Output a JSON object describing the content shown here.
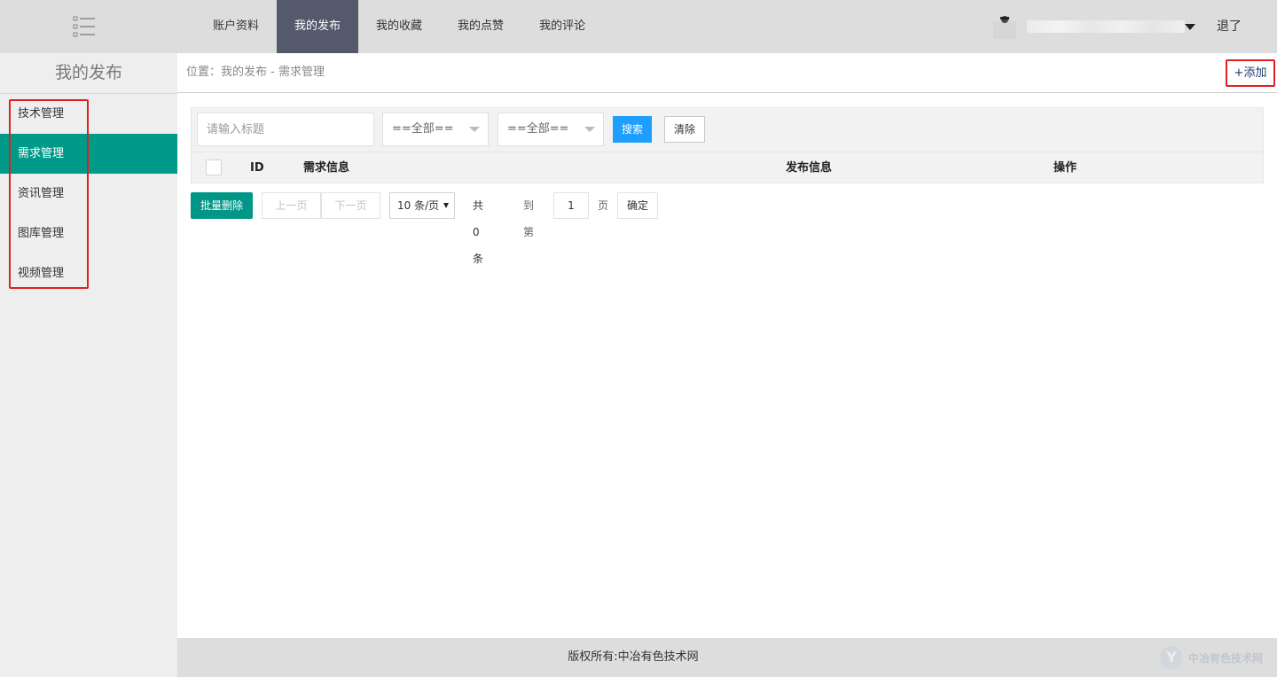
{
  "header": {
    "nav": [
      {
        "label": "账户资料",
        "active": false
      },
      {
        "label": "我的发布",
        "active": true
      },
      {
        "label": "我的收藏",
        "active": false
      },
      {
        "label": "我的点赞",
        "active": false
      },
      {
        "label": "我的评论",
        "active": false
      }
    ],
    "logout_label": "退了",
    "icons": {
      "menu": "list-menu-icon",
      "avatar": "user-avatar-icon",
      "dropdown": "caret-down-icon"
    }
  },
  "sidebar": {
    "title": "我的发布",
    "items": [
      {
        "label": "技术管理",
        "active": false
      },
      {
        "label": "需求管理",
        "active": true
      },
      {
        "label": "资讯管理",
        "active": false
      },
      {
        "label": "图库管理",
        "active": false
      },
      {
        "label": "视频管理",
        "active": false
      }
    ]
  },
  "breadcrumb": {
    "text": "位置：我的发布 - 需求管理"
  },
  "add_label": "+添加",
  "filters": {
    "search_placeholder": "请输入标题",
    "select1": "==全部==",
    "select2": "==全部==",
    "search_label": "搜索",
    "clear_label": "清除"
  },
  "table": {
    "columns": [
      "ID",
      "需求信息",
      "发布信息",
      "操作"
    ],
    "rows": []
  },
  "pagination": {
    "batch_delete_label": "批量删除",
    "prev_label": "上一页",
    "next_label": "下一页",
    "page_size": "10 条/页",
    "total_text": "共 0 条",
    "goto_label": "到第",
    "page_value": "1",
    "page_unit": "页",
    "confirm_label": "确定"
  },
  "footer": {
    "copyright": "版权所有:中冶有色技术网",
    "watermark": "中冶有色技术网"
  },
  "colors": {
    "accent": "#009688",
    "nav_active": "#545a6c",
    "search_button": "#1e9fff",
    "highlight_border": "#e02020"
  }
}
